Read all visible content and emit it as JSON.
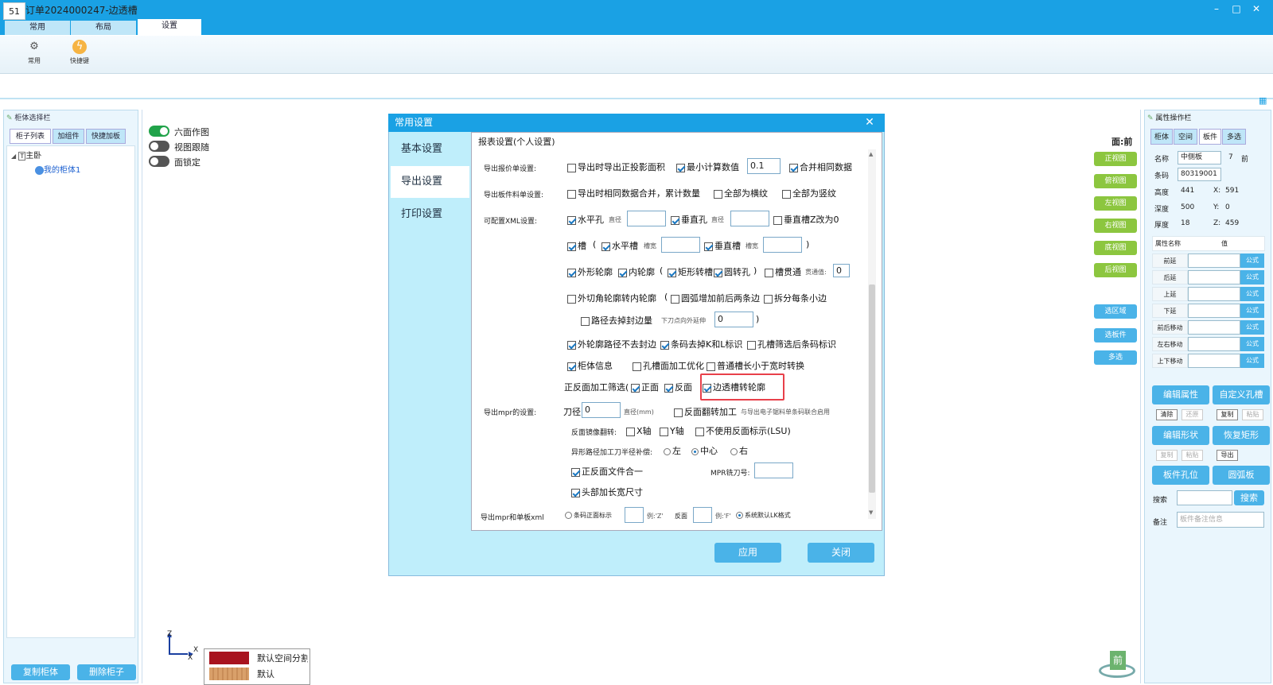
{
  "app": {
    "icon_text": "51",
    "title": "订单2024000247-边透槽",
    "min": "–",
    "max": "□",
    "close": "✕"
  },
  "ribbon": {
    "tabs": [
      "常用",
      "布局",
      "设置"
    ],
    "active_tab": "设置",
    "buttons": [
      {
        "label": "常用",
        "icon": "gear-icon"
      },
      {
        "label": "快捷键",
        "icon": "lightning-icon"
      }
    ]
  },
  "left_panel": {
    "title": "柜体选择栏",
    "tabs": [
      "柜子列表",
      "加组件",
      "快捷加板"
    ],
    "tree_root": "主卧",
    "tree_child": "我的柜体1",
    "copy_btn": "复制柜体",
    "delete_btn": "删除柜子"
  },
  "toggles": [
    {
      "label": "六面作图",
      "on": true
    },
    {
      "label": "视图跟随",
      "on": false
    },
    {
      "label": "面锁定",
      "on": false
    }
  ],
  "view": {
    "face_label": "面:前",
    "view_buttons": [
      "正视图",
      "俯视图",
      "左视图",
      "右视图",
      "底视图",
      "后视图"
    ],
    "select_buttons": [
      "选区域",
      "选板件",
      "多选"
    ],
    "cube_label": "前"
  },
  "axis": {
    "z": "Z",
    "x": "X"
  },
  "legend": [
    {
      "label": "默认空间分割",
      "color": "#a8131e"
    },
    {
      "label": "默认",
      "color": "#d9a06a"
    }
  ],
  "right_panel": {
    "title": "属性操作栏",
    "tabs": [
      "柜体",
      "空间",
      "板件",
      "多选"
    ],
    "active_tab": "板件",
    "name_label": "名称",
    "name_value": "中侧板",
    "name_num": "7",
    "name_side": "前",
    "barcode_label": "条码",
    "barcode_value": "80319001",
    "rows": [
      {
        "k": "高度",
        "v": "441",
        "ak": "X:",
        "av": "591"
      },
      {
        "k": "深度",
        "v": "500",
        "ak": "Y:",
        "av": "0"
      },
      {
        "k": "厚度",
        "v": "18",
        "ak": "Z:",
        "av": "459"
      }
    ],
    "prop_header": [
      "属性名称",
      "值"
    ],
    "props": [
      "前延",
      "后延",
      "上延",
      "下延",
      "前后移动",
      "左右移动",
      "上下移动"
    ],
    "formula": "公式",
    "buttons": {
      "edit_attr": "编辑属性",
      "custom_rect": "自定义孔槽",
      "clear": "清除",
      "restore": "还原",
      "copy": "复制",
      "paste": "粘贴",
      "edit_shape": "编辑形状",
      "restore_rect": "恢复矩形",
      "copy2": "复制",
      "paste2": "粘贴",
      "export": "导出",
      "board_hole": "板件孔位",
      "arc_board": "圆弧板",
      "search_label": "搜索",
      "search_btn": "搜索",
      "note_label": "备注",
      "note_placeholder": "板件备注信息"
    }
  },
  "dialog": {
    "title": "常用设置",
    "close": "✕",
    "nav": [
      "基本设置",
      "导出设置",
      "打印设置"
    ],
    "selected_nav": "导出设置",
    "section": "报表设置(个人设置)",
    "row_quote": "导出报价单设置:",
    "quote_cb1": "导出时导出正投影面积",
    "quote_cb2": "最小计算数值",
    "quote_val": "0.1",
    "quote_cb3": "合并相同数据",
    "row_board": "导出板件料单设置:",
    "board_cb1": "导出时相同数据合并，累计数量",
    "board_cb2": "全部为横纹",
    "board_cb3": "全部为竖纹",
    "row_xml": "可配置XML设置:",
    "hhole": "水平孔",
    "dia": "直径",
    "vhole": "垂直孔",
    "vslotz": "垂直槽Z改为0",
    "slot": "槽",
    "paren_open": "(",
    "hslot": "水平槽",
    "slotw": "槽宽",
    "vslot": "垂直槽",
    "paren_close": ")",
    "outer": "外形轮廓",
    "inner": "内轮廓",
    "rect_slot": "矩形转槽",
    "round_hole": "圆转孔",
    "slot_through": "槽贯通",
    "through_val_label": "贯通值:",
    "through_val": "0",
    "cut_corner": "外切角轮廓转内轮廓",
    "arc_add": "圆弧增加前后两条边",
    "split_edge": "拆分每条小边",
    "path_remove": "路径去掉封边量",
    "down_label": "下刀点向外延伸",
    "down_val": "0",
    "no_edge": "外轮廓路径不去封边",
    "barcode_kl": "条码去掉K和L标识",
    "hole_filter": "孔槽筛选后条码标识",
    "cab_info": "柜体信息",
    "hole_face": "孔槽面加工优化",
    "slot_switch": "普通槽长小于宽时转换",
    "face_filter": "正反面加工筛选(",
    "front": "正面",
    "back": "反面",
    "edge_slot": "边透槽转轮廓",
    "row_mpr": "导出mpr的设置:",
    "knife": "刀径",
    "knife_val": "0",
    "knife_unit": "直径(mm)",
    "flip": "反面翻转加工",
    "flip_note": "与导出电子锯料单条码联合启用",
    "mirror": "反面镜像翻转:",
    "xaxis": "X轴",
    "yaxis": "Y轴",
    "no_back_mark": "不使用反面标示(LSU)",
    "comp": "异形路径加工刀半径补偿:",
    "left": "左",
    "center": "中心",
    "right": "右",
    "merge_file": "正反面文件合一",
    "mpr_knife": "MPR铣刀号:",
    "head_add": "头部加长宽尺寸",
    "row_xml2": "导出mpr和单板xml",
    "front_mark": "条码正面标示",
    "eg_z": "例:'Z'",
    "back_face": "反面",
    "eg_f": "例:'F'",
    "lk_default": "系统默认LK格式",
    "apply": "应用",
    "close_btn": "关闭"
  }
}
